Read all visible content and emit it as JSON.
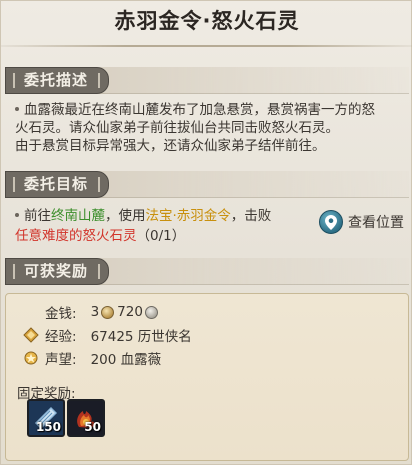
{
  "window": {
    "title": "赤羽金令·怒火石灵"
  },
  "sections": {
    "description": {
      "label": "委托描述"
    },
    "objective": {
      "label": "委托目标"
    },
    "rewards": {
      "label": "可获奖励"
    }
  },
  "description": {
    "line1": "血露薇最近在终南山麓发布了加急悬赏，悬赏祸害一方的怒",
    "line2": "火石灵。请众仙家弟子前往拔仙台共同击败怒火石灵。",
    "line3": "由于悬赏目标异常强大，还请众仙家弟子结伴前往。"
  },
  "objective": {
    "prefix": "前往",
    "location": "终南山麓",
    "mid": "，使用",
    "item_type": "法宝",
    "separator": "·",
    "item_name": "赤羽金令",
    "suffix": "，击败",
    "target": "任意难度的怒火石灵",
    "progress": "（0/1）",
    "locate_label": "查看位置",
    "locate_icon": "map-pin-icon"
  },
  "rewards": {
    "money_label": "金钱:",
    "money_gold": "3",
    "money_silver": "720",
    "exp_label": "经验:",
    "exp_value": "67425 历世侠名",
    "prestige_label": "声望:",
    "prestige_value": "200 血露薇",
    "fixed_label": "固定奖励:",
    "items": [
      {
        "icon": "scroll-item-icon",
        "count": "150"
      },
      {
        "icon": "fire-gauntlet-item-icon",
        "count": "50"
      }
    ]
  },
  "colors": {
    "location": "#3d8f2c",
    "item": "#c8900e",
    "target": "#d2342a"
  }
}
